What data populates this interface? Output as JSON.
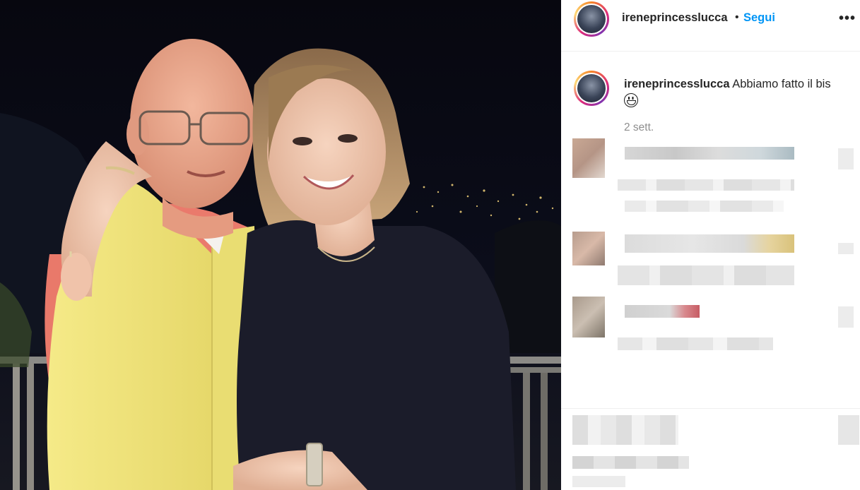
{
  "post": {
    "username": "ireneprincesslucca",
    "dot": "•",
    "follow_label": "Segui",
    "more_label": "•••",
    "caption_username": "ireneprincesslucca",
    "caption_text": "Abbiamo fatto il bis",
    "caption_emoji": "grinning-face-icon",
    "timestamp": "2 sett."
  },
  "colors": {
    "link": "#0095f6",
    "text": "#262626",
    "muted": "#8e8e8e",
    "divider": "#efefef"
  }
}
